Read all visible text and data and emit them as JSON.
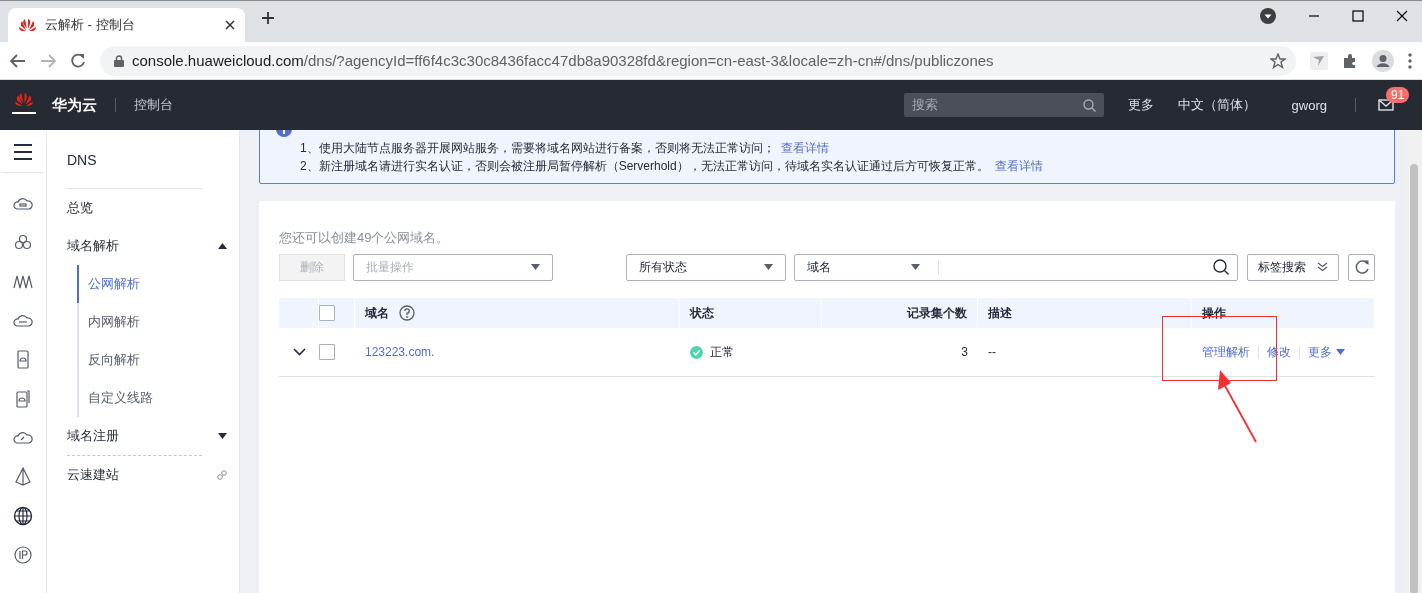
{
  "browser": {
    "tab": {
      "title": "云解析 - 控制台"
    },
    "address": {
      "host": "console.huaweicloud.com",
      "path": "/dns/?agencyId=ff6f4c3c30c8436facc47db8a90328fd&region=cn-east-3&locale=zh-cn#/dns/publiczones"
    }
  },
  "header": {
    "brand": "华为云",
    "console": "控制台",
    "search": {
      "placeholder": "搜索"
    },
    "links": [
      "更多",
      "中文（简体）",
      "gworg"
    ],
    "mail_badge": "91"
  },
  "sidebar": {
    "title": "DNS",
    "items": [
      {
        "label": "总览",
        "kind": "plain"
      },
      {
        "label": "域名解析",
        "kind": "group",
        "expanded": true,
        "children": [
          {
            "label": "公网解析",
            "selected": true
          },
          {
            "label": "内网解析",
            "selected": false
          },
          {
            "label": "反向解析",
            "selected": false
          },
          {
            "label": "自定义线路",
            "selected": false
          }
        ]
      },
      {
        "label": "域名注册",
        "kind": "group",
        "expanded": false
      },
      {
        "label": "云速建站",
        "kind": "external"
      }
    ]
  },
  "notice": {
    "lines": [
      {
        "text": "1、使用大陆节点服务器开展网站服务，需要将域名网站进行备案，否则将无法正常访问；",
        "link": "查看详情"
      },
      {
        "text": "2、新注册域名请进行实名认证，否则会被注册局暂停解析（Serverhold），无法正常访问，待域名实名认证通过后方可恢复正常。",
        "link": "查看详情"
      }
    ]
  },
  "card": {
    "quota": "您还可以创建49个公网域名。",
    "delete_button": {
      "label": "删除",
      "disabled": true
    },
    "batch_select": {
      "placeholder": "批量操作"
    },
    "status_filter": {
      "value": "所有状态"
    },
    "search_type": {
      "value": "域名"
    },
    "tag_search": {
      "label": "标签搜索"
    },
    "table": {
      "header_checked": false,
      "columns": [
        {
          "label": "域名",
          "help": true
        },
        {
          "label": "状态"
        },
        {
          "label": "记录集个数"
        },
        {
          "label": "描述"
        },
        {
          "label": "操作"
        }
      ],
      "rows": [
        {
          "expanded": false,
          "checked": false,
          "domain": "123223.com.",
          "status": {
            "text": "正常",
            "kind": "ok"
          },
          "records": "3",
          "description": "--",
          "actions": [
            {
              "label": "管理解析",
              "menu": false
            },
            {
              "label": "修改",
              "menu": false
            },
            {
              "label": "更多",
              "menu": true
            }
          ]
        }
      ]
    }
  }
}
